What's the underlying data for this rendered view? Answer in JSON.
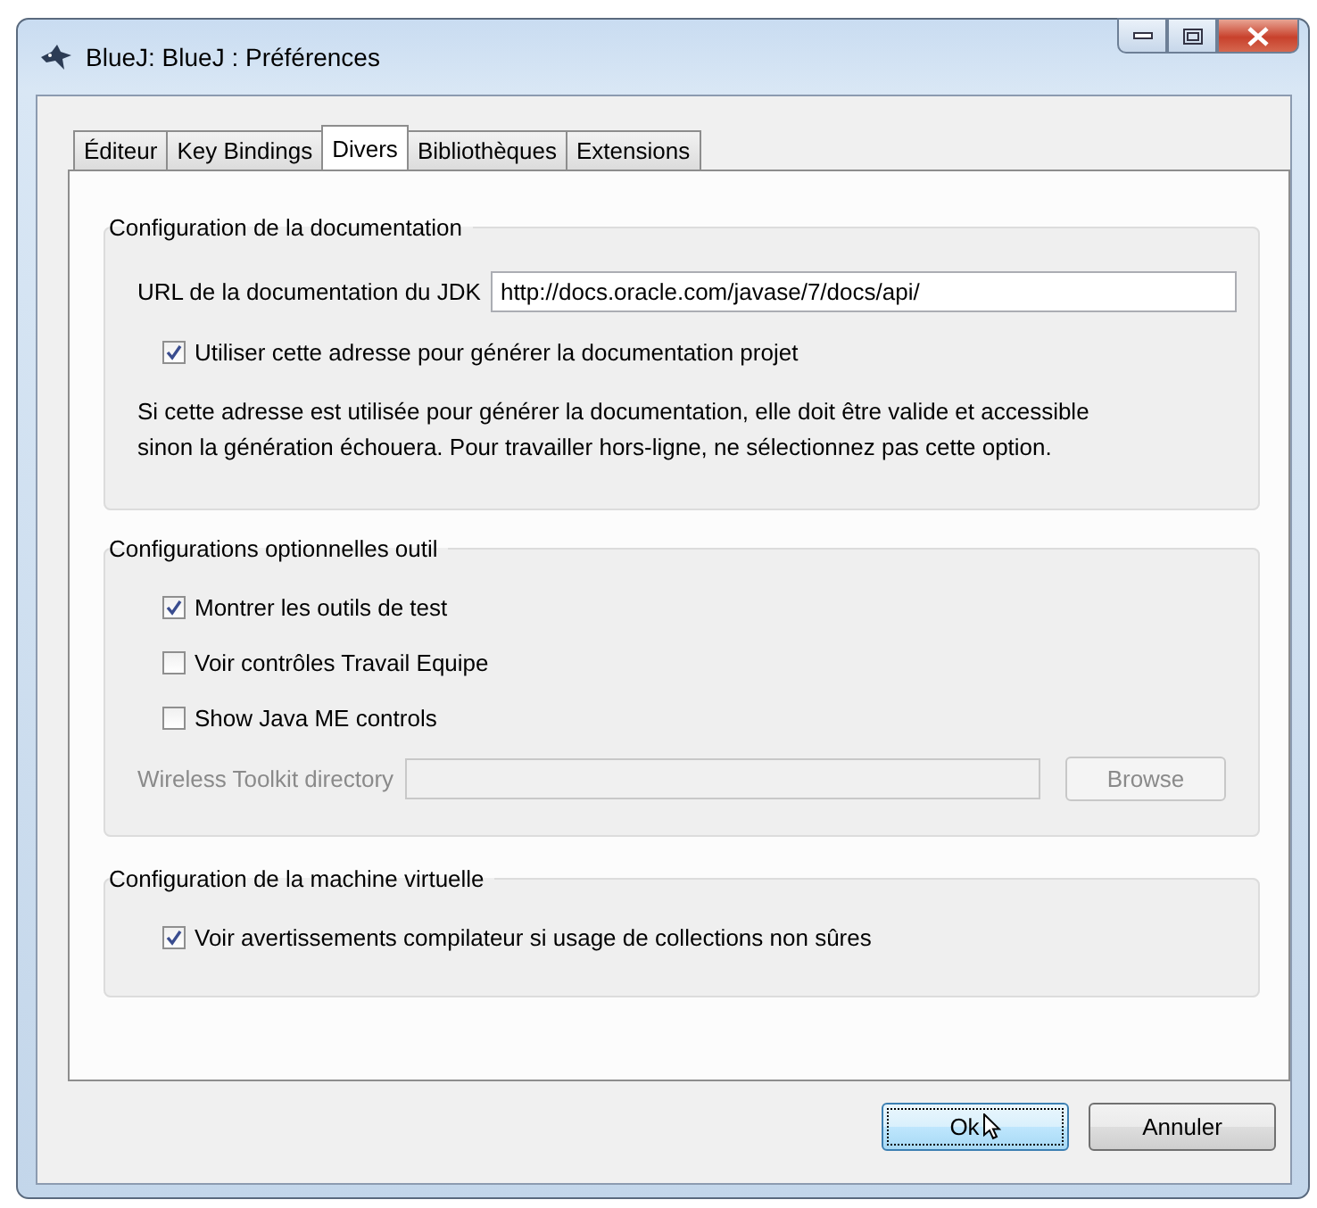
{
  "window": {
    "title": "BlueJ: BlueJ : Préférences"
  },
  "tabs": [
    {
      "label": "Éditeur",
      "selected": false
    },
    {
      "label": "Key Bindings",
      "selected": false
    },
    {
      "label": "Divers",
      "selected": true
    },
    {
      "label": "Bibliothèques",
      "selected": false
    },
    {
      "label": "Extensions",
      "selected": false
    }
  ],
  "sections": [
    {
      "title": "Configuration de la documentation",
      "items": [
        {
          "kind": "field",
          "label": "URL de la documentation du JDK",
          "value": "http://docs.oracle.com/javase/7/docs/api/",
          "disabled": false
        },
        {
          "kind": "checkbox",
          "label": "Utiliser cette adresse pour générer la documentation projet",
          "checked": true
        },
        {
          "kind": "note",
          "text": "Si cette adresse est utilisée pour générer la documentation, elle doit être valide et accessible sinon la génération échouera.  Pour travailler hors-ligne, ne sélectionnez pas cette option."
        }
      ]
    },
    {
      "title": "Configurations optionnelles outil",
      "items": [
        {
          "kind": "checkbox",
          "label": "Montrer les outils de test",
          "checked": true
        },
        {
          "kind": "checkbox",
          "label": "Voir contrôles Travail Equipe",
          "checked": false
        },
        {
          "kind": "checkbox",
          "label": "Show Java ME controls",
          "checked": false
        },
        {
          "kind": "field",
          "label": "Wireless Toolkit directory",
          "disabled": true,
          "button": "Browse"
        }
      ]
    },
    {
      "title": "Configuration de la machine virtuelle",
      "items": [
        {
          "kind": "checkbox",
          "label": "Voir avertissements compilateur si usage de collections non sûres",
          "checked": true
        }
      ]
    }
  ],
  "buttons": [
    {
      "label": "Ok",
      "default": true
    },
    {
      "label": "Annuler",
      "default": false
    }
  ]
}
